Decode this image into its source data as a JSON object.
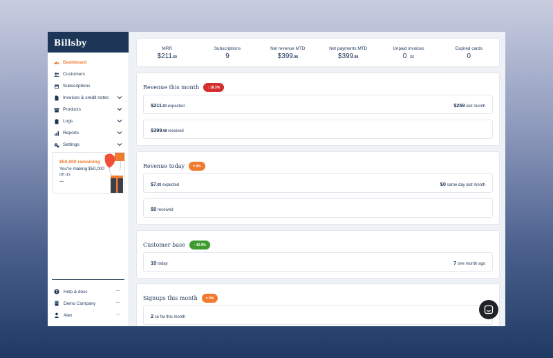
{
  "brand": "Billsby",
  "sidebar": {
    "items": [
      {
        "label": "Dashboard",
        "icon": "gauge-icon",
        "active": true,
        "chevron": false
      },
      {
        "label": "Customers",
        "icon": "users-icon",
        "active": false,
        "chevron": false
      },
      {
        "label": "Subscriptions",
        "icon": "calendar-icon",
        "active": false,
        "chevron": false
      },
      {
        "label": "Invoices & credit notes",
        "icon": "file-icon",
        "active": false,
        "chevron": true
      },
      {
        "label": "Products",
        "icon": "box-icon",
        "active": false,
        "chevron": true
      },
      {
        "label": "Logs",
        "icon": "clipboard-icon",
        "active": false,
        "chevron": true
      },
      {
        "label": "Reports",
        "icon": "chart-icon",
        "active": false,
        "chevron": true
      },
      {
        "label": "Settings",
        "icon": "gears-icon",
        "active": false,
        "chevron": true
      }
    ],
    "promo": {
      "title": "$50,000 remaining",
      "text": "You're making $50,000 on us",
      "more": "..."
    },
    "bottom": [
      {
        "label": "Help & docs",
        "icon": "question-icon",
        "more": "···"
      },
      {
        "label": "Demo Company",
        "icon": "building-icon",
        "more": "···"
      },
      {
        "label": "Alex",
        "icon": "user-icon",
        "more": "···"
      }
    ]
  },
  "stats": [
    {
      "label": "MRR",
      "value": "$211",
      "cents": ".60",
      "sub": ""
    },
    {
      "label": "Subscriptions",
      "value": "9",
      "cents": "",
      "sub": ""
    },
    {
      "label": "Net revenue MTD",
      "value": "$399",
      "cents": ".98",
      "sub": ""
    },
    {
      "label": "Net payments MTD",
      "value": "$399",
      "cents": ".98",
      "sub": ""
    },
    {
      "label": "Unpaid invoices",
      "value": "0",
      "cents": "",
      "sub": "$0"
    },
    {
      "label": "Expired cards",
      "value": "0",
      "cents": "",
      "sub": ""
    }
  ],
  "revenue_month": {
    "title": "Revenue this month",
    "badge": "↓ 18.3%",
    "expected_value": "$211",
    "expected_cents": ".60",
    "expected_label": "expected",
    "last_value": "$259",
    "last_label": "last month",
    "received_value": "$399",
    "received_cents": ".98",
    "received_label": "received"
  },
  "revenue_today": {
    "title": "Revenue today",
    "badge": "= 0%",
    "expected_value": "$7",
    "expected_cents": ".05",
    "expected_label": "expected",
    "last_value": "$0",
    "last_label": "same day last month",
    "received_value": "$0",
    "received_label": "received"
  },
  "customer_base": {
    "title": "Customer base",
    "badge": "↑ 42.9%",
    "today_value": "10",
    "today_label": "today",
    "ago_value": "7",
    "ago_label": "one month ago"
  },
  "signups": {
    "title": "Signups this month",
    "badge": "= 0%",
    "value": "2",
    "label": "so far this month"
  },
  "colors": {
    "accent": "#f07a2e",
    "navy": "#1d3557",
    "red": "#d32f2f",
    "green": "#3c9a2f"
  }
}
